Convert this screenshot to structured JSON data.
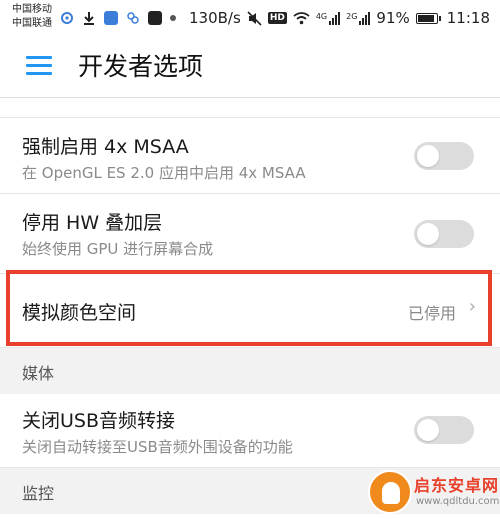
{
  "status_bar": {
    "carrier_1": "中国移动",
    "carrier_2": "中国联通",
    "speed": "130B/s",
    "hd": "HD",
    "signal_tag_4g": "4G",
    "signal_tag_2g": "2G",
    "battery": "91%",
    "battery_level": 0.91,
    "time": "11:18"
  },
  "app_bar": {
    "title": "开发者选项"
  },
  "rows": [
    {
      "title": "强制启用 4x MSAA",
      "subtitle": "在 OpenGL ES 2.0 应用中启用 4x MSAA",
      "toggle_on": false
    },
    {
      "title": "停用 HW 叠加层",
      "subtitle": "始终使用 GPU 进行屏幕合成",
      "toggle_on": false
    },
    {
      "title": "模拟颜色空间",
      "value": "已停用",
      "chevron": "›"
    }
  ],
  "sections": {
    "media": {
      "label": "媒体",
      "rows": [
        {
          "title": "关闭USB音频转接",
          "subtitle": "关闭自动转接至USB音频外围设备的功能",
          "toggle_on": false
        }
      ]
    },
    "monitoring": {
      "label": "监控"
    }
  },
  "watermark": {
    "text": "启东安卓网",
    "url": "www.qdltdu.com"
  },
  "colors": {
    "accent": "#2196f3",
    "highlight": "#e8402a",
    "toggle_off": "#dcdcdc"
  }
}
